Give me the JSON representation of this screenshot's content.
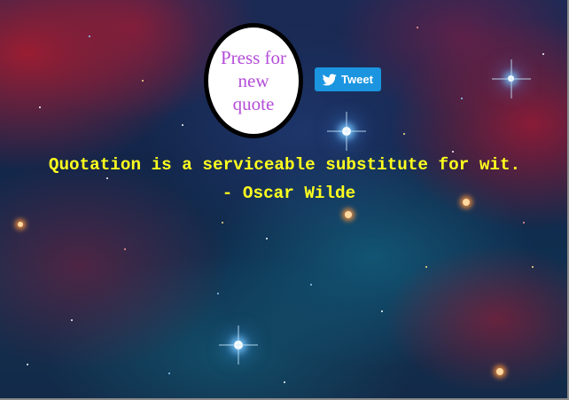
{
  "new_quote_button": {
    "label": "Press for new quote",
    "text_color": "#b44dd8"
  },
  "tweet_button": {
    "label": "Tweet",
    "icon": "twitter-bird-icon",
    "color": "#1b95e0"
  },
  "quote": {
    "text": "Quotation is a serviceable substitute for wit.",
    "author": "- Oscar Wilde",
    "color": "#ffff1e"
  },
  "background": {
    "theme": "starry-nebula"
  }
}
